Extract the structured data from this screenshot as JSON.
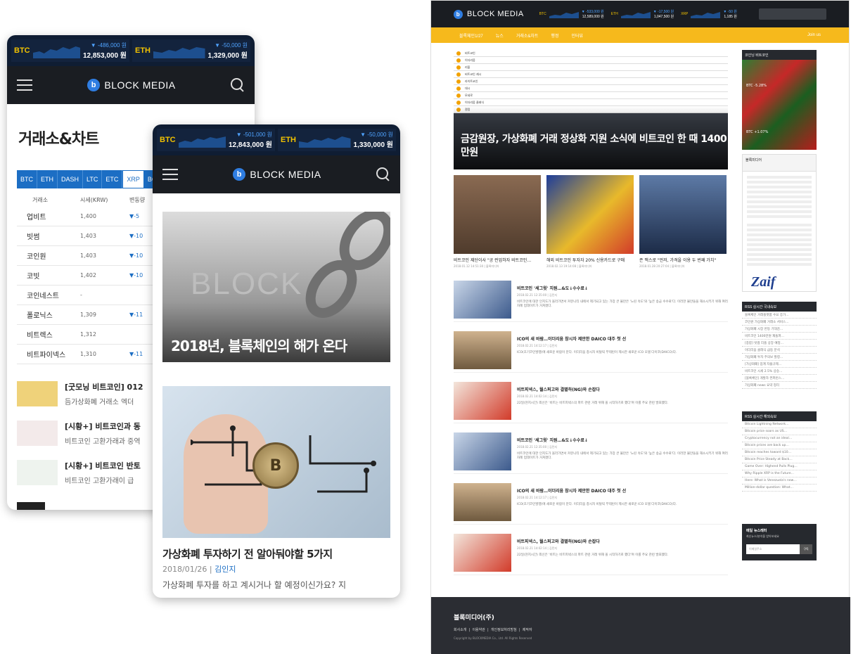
{
  "brand": {
    "name": "BLOCK MEDIA",
    "mark": "b"
  },
  "phone1": {
    "ticker": [
      {
        "sym": "BTC",
        "chg": "▼ -486,000 원",
        "price": "12,853,000 원"
      },
      {
        "sym": "ETH",
        "chg": "▼ -50,000 원",
        "price": "1,329,000 원"
      }
    ],
    "title": "거래소&차트",
    "coin_tabs": [
      "BTC",
      "ETH",
      "DASH",
      "LTC",
      "ETC",
      "XRP",
      "BC"
    ],
    "active_tab": "XRP",
    "exchange_header": [
      "거래소",
      "시세(KRW)",
      "변동량"
    ],
    "exchanges": [
      {
        "name": "업비트",
        "price": "1,400",
        "chg": "▼-5"
      },
      {
        "name": "빗썸",
        "price": "1,403",
        "chg": "▼-10"
      },
      {
        "name": "코인원",
        "price": "1,403",
        "chg": "▼-10"
      },
      {
        "name": "코빗",
        "price": "1,402",
        "chg": "▼-10"
      },
      {
        "name": "코인네스트",
        "price": "-",
        "chg": ""
      },
      {
        "name": "폴로닉스",
        "price": "1,309",
        "chg": "▼-11"
      },
      {
        "name": "비트렉스",
        "price": "1,312",
        "chg": ""
      },
      {
        "name": "비트파이넥스",
        "price": "1,310",
        "chg": "▼-11"
      }
    ],
    "news": [
      {
        "title": "[굿모닝 비트코인] 012",
        "summary": "듬가상화폐 거래소 엑더"
      },
      {
        "title": "[시황+] 비트코인과 동",
        "summary": "비트코인 고환가래과 중역"
      },
      {
        "title": "[시황+] 비트코인 반토",
        "summary": "비트코인 고환가래이 급"
      }
    ]
  },
  "phone2": {
    "ticker": [
      {
        "sym": "BTC",
        "chg": "▼ -501,000 원",
        "price": "12,843,000 원"
      },
      {
        "sym": "ETH",
        "chg": "▼ -50,000 원",
        "price": "1,330,000 원"
      }
    ],
    "hero_bg_text": "BLOCK",
    "hero_caption": "2018년, 블록체인의 해가 온다",
    "article": {
      "title": "가상화폐 투자하기 전 알아둬야할 5가지",
      "date": "2018/01/26",
      "author": "김인지",
      "body": "가상화폐 투자를 하고 계시거나 할 예정이신가요? 지"
    }
  },
  "desktop": {
    "ticker": [
      {
        "sym": "BTC",
        "chg": "▼ -533,000 원",
        "price": "12,589,000 원"
      },
      {
        "sym": "ETH",
        "chg": "▼ -17,500 원",
        "price": "1,047,500 원"
      },
      {
        "sym": "XRP",
        "chg": "▼ -50 원",
        "price": "1,185 원"
      }
    ],
    "menu": [
      "블록체인1/27",
      "뉴스",
      "거래소&차트",
      "행정",
      "인터뷰"
    ],
    "menu_right": "Join us",
    "hero_rows": [
      "비트코인",
      "이더리움",
      "리플",
      "비트코인 캐시",
      "라이트코인",
      "대시",
      "모네로",
      "이더리움 클래식",
      "퀀텀"
    ],
    "hero_caption": "금감원장, 가상화폐 거래 정상화 지원 소식에 비트코인 한 때 1400만원",
    "thumbs": [
      {
        "title": "비트코인 제단이사 \"공 런업하자 비트코인…",
        "meta": "2018.01.12 14:51:30 | 블록미디어"
      },
      {
        "title": "해외 비트코인 투자자 20% 신용카드로 구매",
        "meta": "2018.02.13 19:14:08 | 블록미디어"
      },
      {
        "title": "존 맥스로 \"먼저, 가격을 이용 두 번째 가치\"",
        "meta": "2018.01.28 20:27:04 | 블록미디어"
      }
    ],
    "news": [
      {
        "title": "비트코인 '세그윗' 지원…&도↓수수료↓",
        "meta": "2018.02.21 12:35:00 | 김민지",
        "summary": "비트코인에 대한 인지도가 올라가면서 커뮤니티 내에서 제기되고 있는 가장 큰 불만은 '느린 속도'와 '높은 송금 수수료'다. 이러한 불만들을 해소시키기 위해 여러 차례 업데이트가 거쳐졌다."
      },
      {
        "title": "ICO의 새 바람…이더리움 창시자 제안한 DAICO 대주 첫 선",
        "meta": "2018.02.21 14:12:17 | 김민지",
        "summary": "ICO(초기코인발행)에 새로운 바람이 분다. 이더리움 창시자 비탈릭 부테린이 제시한 새로운 ICO 모델 다이코(DAICO)다."
      },
      {
        "title": "비트피넥스, 월스퍼고와 결별하(NG)와 손잡다",
        "meta": "2018.02.21 14:02:14 | 김민지",
        "summary": "22일(현지시간) 외신은 '비트는 비트피넥스의 파트 관련 거래 위해 올 시작하기로 했다'며 이를 주요 관련 발표했다."
      },
      {
        "title": "비트코인 '세그윗' 지원…&도↓수수료↓",
        "meta": "2018.02.21 12:35:00 | 김민지",
        "summary": "비트코인에 대한 인지도가 올라가면서 커뮤니티 내에서 제기되고 있는 가장 큰 불만은 '느린 속도'와 '높은 송금 수수료'다. 이러한 불만들을 해소시키기 위해 여러 차례 업데이트가 거쳐졌다."
      },
      {
        "title": "ICO의 새 바람…이더리움 창시자 제안한 DAICO 대주 첫 선",
        "meta": "2018.02.21 14:12:17 | 김민지",
        "summary": "ICO(초기코인발행)에 새로운 바람이 분다. 이더리움 창시자 비탈릭 부테린이 제시한 새로운 ICO 모델 다이코(DAICO)다."
      },
      {
        "title": "비트피넥스, 월스퍼고와 결별하(NG)와 손잡다",
        "meta": "2018.02.21 14:02:14 | 김민지",
        "summary": "22일(현지시간) 외신은 '비트는 비트피넥스의 파트 관련 거래 위해 올 시작하기로 했다'며 이를 주요 관련 발표했다."
      }
    ],
    "side": {
      "heatmap_title": "코인닝 비트코인",
      "heatmap_labels": [
        "BTC -5.28%",
        "BTC +1.07%"
      ],
      "fb_title": "블록미디어",
      "ad_text": "Zaif",
      "rss_kr_title": "RSS 실시간 국내속보",
      "rss_kr": [
        "블록체인 거래플랫폼 수요 증가…",
        "코인원 가상화폐 거래소 서비스…",
        "가상화폐 시장 반등 기대감…",
        "비트코인 1400만원 재돌파…",
        "[종합] 빗썸 리플 상장 예정…",
        "이더리움 클래식 급등 분석",
        "가상화폐 투자 주의보 발령…",
        "[가상화폐] 업계 자율규제…",
        "비트코인 시세 2.5% 상승…",
        "[블록체인] 개발자 컨퍼런스…",
        "가상화폐 news 요약 정리"
      ],
      "rss_en_title": "RSS 실시간 해외속보",
      "rss_en": [
        "Bitcoin Lightning Network…",
        "Bitcoin price soars as US…",
        "Cryptocurrency not an ideal…",
        "Bitcoin prices are back up…",
        "Bitcoin reaches toward $10…",
        "Bitcoin Price Steady at Back…",
        "Game Over: Highend Pulls Plug…",
        "Why Ripple XRP is the Future…",
        "Here: What is Venezuela's new…",
        "Million-dollar question: What…"
      ],
      "newsletter_title": "메일 뉴스레터",
      "newsletter_sub": "최신뉴스/분석을 받아보세요",
      "newsletter_placeholder": "이메일주소",
      "newsletter_btn": "구독"
    },
    "footer": {
      "company": "블록미디어(주)",
      "links": [
        "회사소개",
        "이용약관",
        "개인정보처리방침",
        "제작자"
      ],
      "copyright": "Copyright by BLOCKMEDIA Co., Ltd. All Rights Reserved"
    }
  }
}
